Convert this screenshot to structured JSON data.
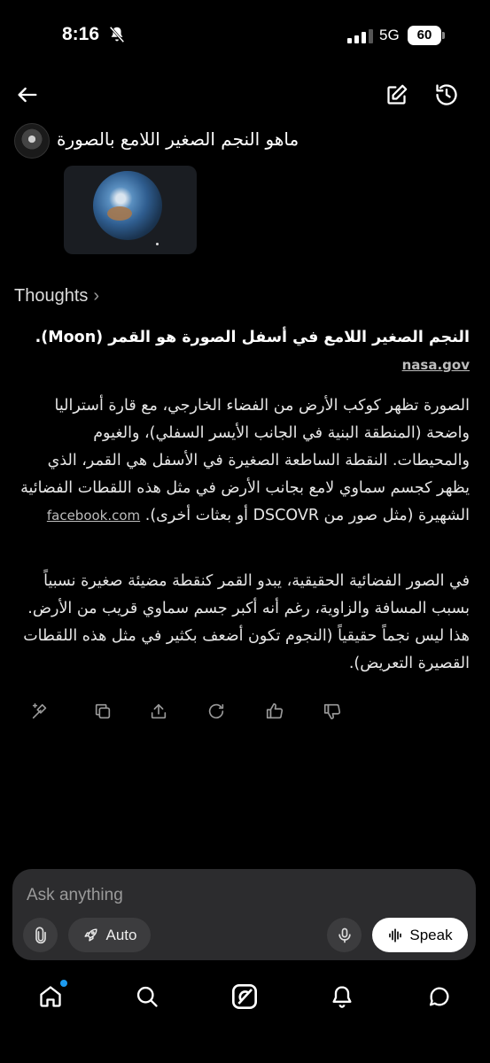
{
  "status_bar": {
    "time": "8:16",
    "network": "5G",
    "battery": "60"
  },
  "nav": {
    "back": "arrow-left-icon",
    "edit": "edit-icon",
    "history": "history-icon"
  },
  "prompt": {
    "text": "ماهو النجم الصغير اللامع بالصورة"
  },
  "thoughts_label": "Thoughts",
  "answer": {
    "heading": "النجم الصغير اللامع في أسفل الصورة هو القمر (Moon).",
    "heading_source": "nasa.gov",
    "paragraph1": "الصورة تظهر كوكب الأرض من الفضاء الخارجي، مع قارة أستراليا واضحة (المنطقة البنية في الجانب الأيسر السفلي)، والغيوم والمحيطات. النقطة الساطعة الصغيرة في الأسفل هي القمر، الذي يظهر كجسم سماوي لامع بجانب الأرض في مثل هذه اللقطات الفضائية الشهيرة (مثل صور من DSCOVR أو بعثات أخرى).",
    "paragraph1_source": "facebook.com",
    "paragraph2": "في الصور الفضائية الحقيقية، يبدو القمر كنقطة مضيئة صغيرة نسبياً بسبب المسافة والزاوية، رغم أنه أكبر جسم سماوي قريب من الأرض. هذا ليس نجماً حقيقياً (النجوم تكون أضعف بكثير في مثل هذه اللقطات القصيرة التعريض)."
  },
  "actions": [
    "regenerate-spark-icon",
    "copy-icon",
    "share-icon",
    "refresh-icon",
    "thumbs-up-icon",
    "thumbs-down-icon"
  ],
  "composer": {
    "placeholder": "Ask anything",
    "mode_label": "Auto",
    "speak_label": "Speak"
  },
  "bottom_nav": [
    "home-icon",
    "search-icon",
    "grok-icon",
    "notifications-icon",
    "messages-icon"
  ],
  "colors": {
    "background": "#000000",
    "composer": "#2c2c2e",
    "accent": "#1d9bf0"
  }
}
